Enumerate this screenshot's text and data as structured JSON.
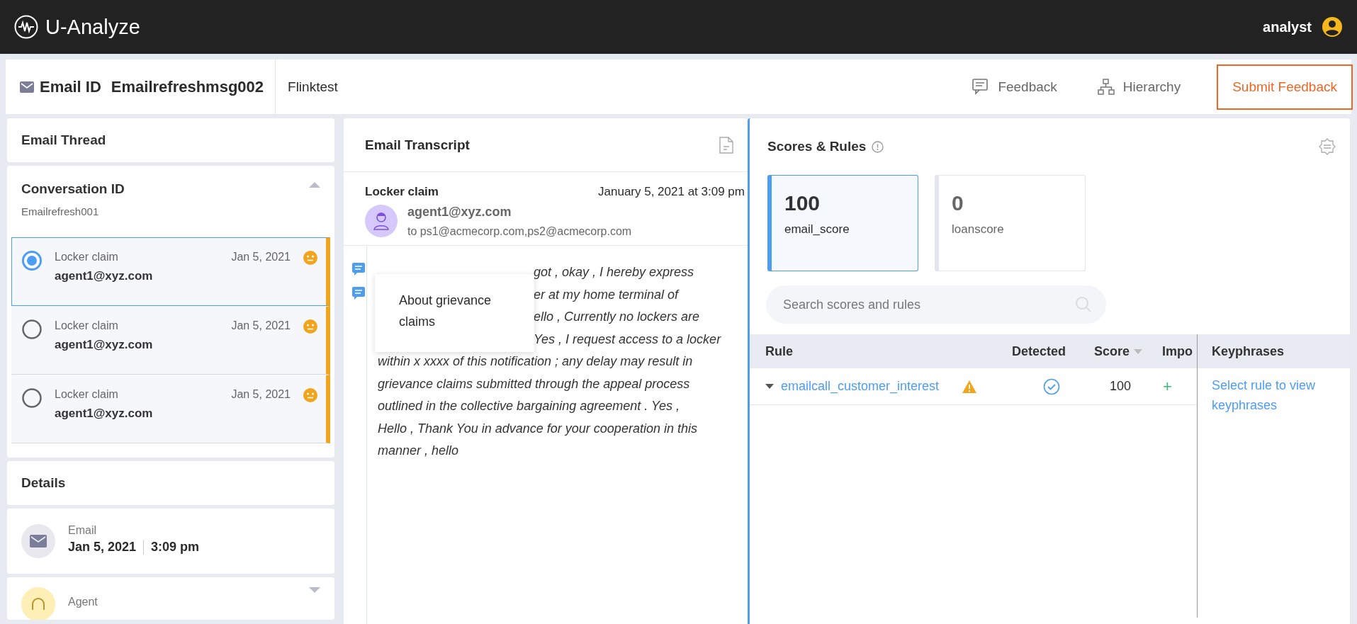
{
  "app": {
    "name": "U-Analyze",
    "user": "analyst"
  },
  "header": {
    "label": "Email ID",
    "email_id": "Emailrefreshmsg002",
    "tenant": "Flinktest",
    "actions": [
      {
        "label": "Feedback",
        "kind": "feedback"
      },
      {
        "label": "Hierarchy",
        "kind": "hierarchy"
      }
    ],
    "submit": "Submit Feedback"
  },
  "thread": {
    "title": "Email Thread",
    "conversation_label": "Conversation ID",
    "conversation_id": "Emailrefresh001",
    "expanded": true,
    "messages": [
      {
        "subject": "Locker claim",
        "date": "Jan 5, 2021",
        "sender": "agent1@xyz.com",
        "selected": true
      },
      {
        "subject": "Locker claim",
        "date": "Jan 5, 2021",
        "sender": "agent1@xyz.com",
        "selected": false
      },
      {
        "subject": "Locker claim",
        "date": "Jan 5, 2021",
        "sender": "agent1@xyz.com",
        "selected": false
      }
    ]
  },
  "details": {
    "title": "Details",
    "items": [
      {
        "kind": "email",
        "label": "Email",
        "date": "Jan 5, 2021",
        "time": "3:09 pm"
      },
      {
        "kind": "agent",
        "label": "Agent",
        "expanded": false
      }
    ]
  },
  "transcript": {
    "title": "Email Transcript",
    "subject": "Locker claim",
    "datetime": "January 5, 2021 at 3:09 pm",
    "sender": "agent1@xyz.com",
    "recipients": "to ps1@acmecorp.com,ps2@acmecorp.com",
    "popup": "About grievance claims",
    "partial_lines": [
      "got , okay , I hereby express",
      "er at my home terminal of",
      "ello , Currently no lockers are",
      "Yes , I request access to a locker"
    ],
    "lines": [
      "within x xxxx of this notification ; any delay may result in",
      "grievance claims submitted through the appeal process",
      "outlined in the collective bargaining agreement . Yes ,",
      "Hello , Thank You in advance for your cooperation in this",
      "manner , hello"
    ]
  },
  "scores": {
    "title": "Scores & Rules",
    "cards": [
      {
        "value": "100",
        "name": "email_score",
        "selected": true
      },
      {
        "value": "0",
        "name": "loanscore",
        "selected": false
      }
    ],
    "search": {
      "placeholder": "Search scores and rules"
    },
    "table": {
      "columns": [
        {
          "label": "Rule",
          "sorted": false
        },
        {
          "label": "Detected",
          "sorted": false
        },
        {
          "label": "Score",
          "sorted": true
        },
        {
          "label": "Impo"
        }
      ],
      "rows": [
        {
          "rule": "emailcall_customer_interest",
          "expanded": false,
          "warning": true,
          "detected": true,
          "score": "100",
          "impact": "+"
        }
      ]
    },
    "keyphrases": {
      "title": "Keyphrases",
      "hint": "Select rule to view keyphrases"
    }
  }
}
